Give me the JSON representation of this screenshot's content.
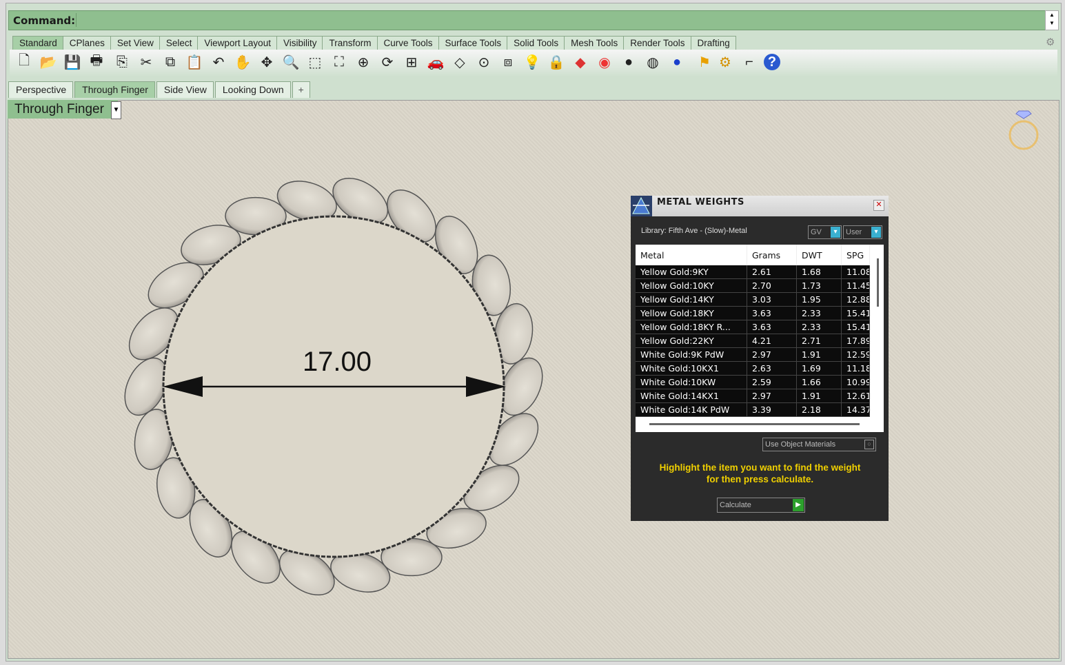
{
  "command": {
    "label": "Command:",
    "value": ""
  },
  "tool_tabs": [
    "Standard",
    "CPlanes",
    "Set View",
    "Select",
    "Viewport Layout",
    "Visibility",
    "Transform",
    "Curve Tools",
    "Surface Tools",
    "Solid Tools",
    "Mesh Tools",
    "Render Tools",
    "Drafting"
  ],
  "toolbar_icons": [
    "new-file",
    "open-folder",
    "save",
    "print",
    "import",
    "cut",
    "copy",
    "paste",
    "undo",
    "pan-hand",
    "move",
    "zoom-in",
    "zoom-window",
    "zoom-extents",
    "zoom-selected",
    "rotate-view",
    "four-viewports",
    "car-render",
    "blocks",
    "target",
    "layers",
    "light-bulb",
    "lock",
    "paint-bucket",
    "color-wheel",
    "sphere-shaded",
    "sphere-wire",
    "blue-sphere",
    "flag",
    "gear-settings",
    "dimension",
    "help"
  ],
  "viewport_tabs": [
    "Perspective",
    "Through Finger",
    "Side View",
    "Looking Down"
  ],
  "viewport": {
    "title": "Through Finger",
    "dimension_text": "17.00"
  },
  "panel": {
    "title": "METAL WEIGHTS",
    "library": "Library: Fifth Ave - (Slow)-Metal",
    "select1": "GV",
    "select2": "User",
    "columns": [
      "Metal",
      "Grams",
      "DWT",
      "SPG"
    ],
    "rows": [
      [
        "Yellow Gold:9KY",
        "2.61",
        "1.68",
        "11.08"
      ],
      [
        "Yellow Gold:10KY",
        "2.70",
        "1.73",
        "11.45"
      ],
      [
        "Yellow Gold:14KY",
        "3.03",
        "1.95",
        "12.88"
      ],
      [
        "Yellow Gold:18KY",
        "3.63",
        "2.33",
        "15.41"
      ],
      [
        "Yellow Gold:18KY R...",
        "3.63",
        "2.33",
        "15.41"
      ],
      [
        "Yellow Gold:22KY",
        "4.21",
        "2.71",
        "17.89"
      ],
      [
        "White Gold:9K PdW",
        "2.97",
        "1.91",
        "12.59"
      ],
      [
        "White Gold:10KX1",
        "2.63",
        "1.69",
        "11.18"
      ],
      [
        "White Gold:10KW",
        "2.59",
        "1.66",
        "10.99"
      ],
      [
        "White Gold:14KX1",
        "2.97",
        "1.91",
        "12.61"
      ],
      [
        "White Gold:14K PdW",
        "3.39",
        "2.18",
        "14.37"
      ]
    ],
    "use_object_materials": "Use Object Materials",
    "hint_line1": "Highlight the item you want to find the weight",
    "hint_line2": "for then press calculate.",
    "calculate_label": "Calculate"
  }
}
